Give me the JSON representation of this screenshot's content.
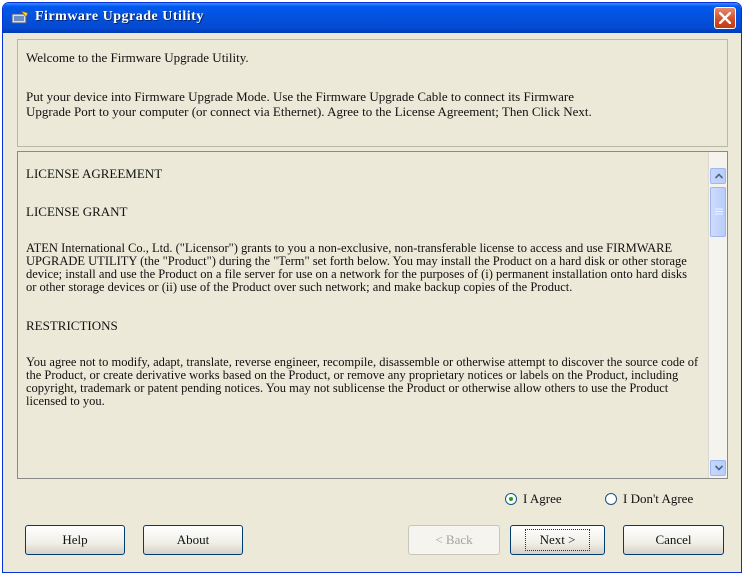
{
  "window": {
    "title": "Firmware Upgrade Utility",
    "accent_color": "#0451dc",
    "close_color": "#d14b25"
  },
  "intro": {
    "line1": "Welcome to the Firmware Upgrade Utility.",
    "line2": "Put your device into Firmware Upgrade Mode. Use the Firmware Upgrade Cable to connect its Firmware",
    "line3": "Upgrade Port to your computer (or connect via Ethernet). Agree to the License Agreement; Then Click Next."
  },
  "license": {
    "heading": "LICENSE AGREEMENT",
    "grant_heading": "LICENSE GRANT",
    "grant_text": "ATEN International Co., Ltd. (\"Licensor\") grants to you a non-exclusive, non-transferable license to access and use FIRMWARE UPGRADE UTILITY (the \"Product\") during the \"Term\" set forth below. You may install the Product on a hard disk or other storage device; install and use the Product on a file server for use on a network for the purposes of (i) permanent installation onto hard disks or other storage devices or (ii) use of the Product over such network; and make backup copies of the Product.",
    "restrictions_heading": "RESTRICTIONS",
    "restrictions_text": "You agree not to modify, adapt, translate, reverse engineer, recompile, disassemble or otherwise attempt to discover the source code of the Product, or create derivative works based on the Product, or remove any proprietary notices or labels on the Product, including copyright, trademark or patent pending notices. You may not sublicense the Product or otherwise allow others to use the Product licensed to you."
  },
  "agreement": {
    "agree_label": "I Agree",
    "disagree_label": "I Don't Agree",
    "selected": "I Agree"
  },
  "buttons": {
    "help": "Help",
    "about": "About",
    "back": "< Back",
    "next": "Next >",
    "cancel": "Cancel"
  },
  "icons": [
    "app-icon",
    "close-icon",
    "scroll-up-arrow-icon",
    "scroll-down-arrow-icon",
    "scroll-thumb-grip-icon"
  ]
}
